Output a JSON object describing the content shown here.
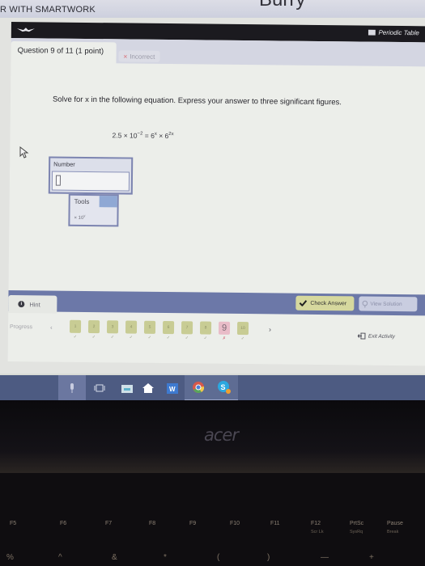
{
  "site": {
    "title": "R WITH SMARTWORK",
    "partial_heading": "Burry"
  },
  "activity": {
    "logo_icon": "smartwork-bird-icon",
    "periodic_table_label": "Periodic Table",
    "question_header": "Question 9 of 11 (1 point)",
    "status": {
      "icon": "x-icon",
      "label": "Incorrect",
      "color": "#d98a92"
    },
    "question_text": "Solve for x in the following equation. Express your answer to three significant figures.",
    "equation": {
      "lhs_coefficient": "2.5",
      "times": "×",
      "base10": "10",
      "exp10": "−2",
      "equals": "=",
      "base_a": "6",
      "exp_a": "x",
      "times2": "×",
      "base_b": "6",
      "exp_b": "2x"
    },
    "answer": {
      "label": "Number",
      "value": "",
      "placeholder": ""
    },
    "tools": {
      "label": "Tools",
      "option_prefix": "× 10",
      "option_exp": "y"
    },
    "hint_label": "Hint",
    "check_answer_label": "Check Answer",
    "view_solution_label": "View Solution",
    "progress": {
      "label": "Progress",
      "current": 9,
      "pages": [
        {
          "label": "1",
          "status": "correct",
          "mark": "✓"
        },
        {
          "label": "2",
          "status": "correct",
          "mark": "✓"
        },
        {
          "label": "3",
          "status": "correct",
          "mark": "✓"
        },
        {
          "label": "4",
          "status": "correct",
          "mark": "✓"
        },
        {
          "label": "5",
          "status": "correct",
          "mark": "✓"
        },
        {
          "label": "6",
          "status": "correct",
          "mark": "✓"
        },
        {
          "label": "7",
          "status": "correct",
          "mark": "✓"
        },
        {
          "label": "8",
          "status": "correct",
          "mark": "✓"
        },
        {
          "label": "9",
          "status": "incorrect",
          "mark": "✗"
        },
        {
          "label": "10",
          "status": "correct",
          "mark": "✓"
        }
      ],
      "prev": "‹",
      "next": "›"
    },
    "exit_label": "Exit Activity",
    "accent_colors": {
      "topbar": "#1b1a1f",
      "footer": "#6c78a8",
      "check_button": "#d6d89e",
      "current_page": "#e9bcc8"
    }
  },
  "taskbar": {
    "items": [
      {
        "name": "microphone-icon"
      },
      {
        "name": "task-view-icon"
      },
      {
        "name": "file-explorer-icon"
      },
      {
        "name": "home-icon"
      },
      {
        "name": "word-icon"
      },
      {
        "name": "chrome-icon"
      },
      {
        "name": "skype-icon"
      }
    ]
  },
  "laptop": {
    "brand": "acer",
    "fkeys": [
      {
        "label": "F5",
        "sub": ""
      },
      {
        "label": "F6",
        "sub": ""
      },
      {
        "label": "F7",
        "sub": ""
      },
      {
        "label": "F8",
        "sub": ""
      },
      {
        "label": "F9",
        "sub": ""
      },
      {
        "label": "F10",
        "sub": ""
      },
      {
        "label": "F11",
        "sub": ""
      },
      {
        "label": "F12",
        "sub": "Scr Lk"
      },
      {
        "label": "PrtSc",
        "sub": "SysRq"
      },
      {
        "label": "Pause",
        "sub": "Break"
      }
    ],
    "symbols": [
      "%",
      "^",
      "&",
      "*",
      "(",
      ")",
      "—",
      "+"
    ]
  }
}
